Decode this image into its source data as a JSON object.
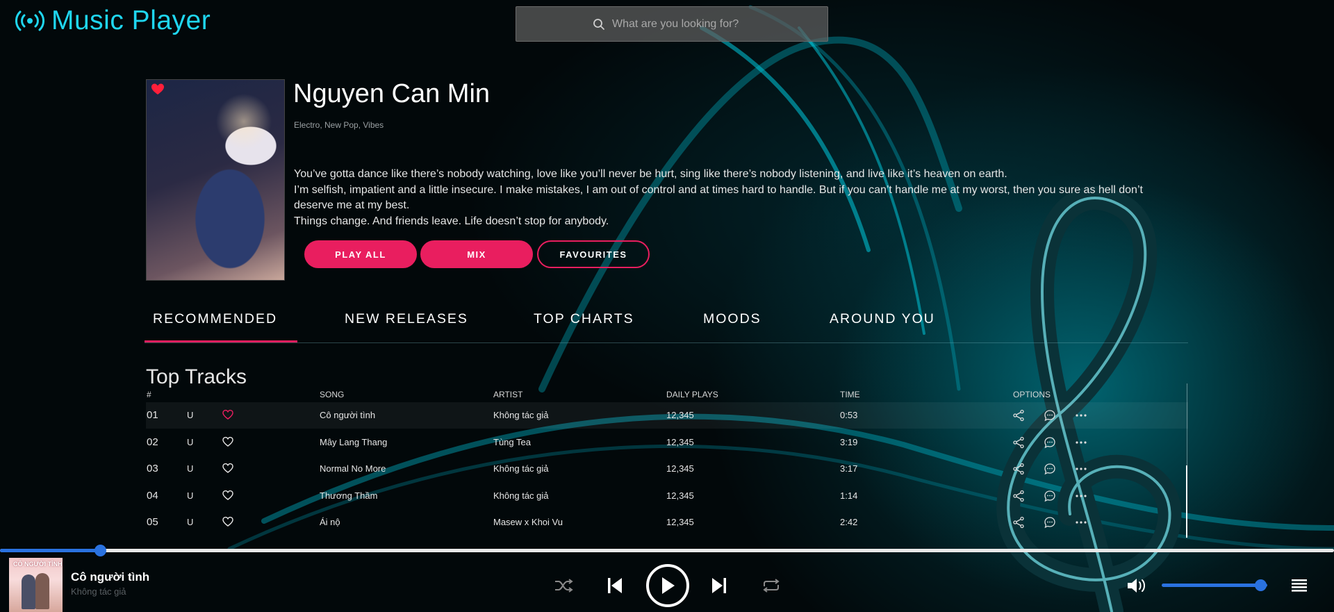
{
  "app": {
    "title": "Music Player",
    "accent": "#1fd6f0",
    "brand_pink": "#e91e5f",
    "player_blue": "#2a72e0"
  },
  "search": {
    "placeholder": "What are you looking for?",
    "value": ""
  },
  "artist": {
    "name": "Nguyen Can Min",
    "genres": "Electro, New Pop, Vibes",
    "bio": [
      "You’ve gotta dance like there’s nobody watching, love like you’ll never be hurt, sing like there’s nobody listening, and live like it’s heaven on earth.",
      "I’m selfish, impatient and a little insecure. I make mistakes, I am out of control and at times hard to handle. But if you can’t handle me at my worst, then you sure as hell don’t deserve me at my best.",
      "Things change. And friends leave. Life doesn’t stop for anybody."
    ],
    "favorited": true,
    "buttons": {
      "play_all": "PLAY ALL",
      "mix": "MIX",
      "favourites": "FAVOURITES"
    }
  },
  "tabs": [
    {
      "label": "RECOMMENDED",
      "active": true
    },
    {
      "label": "NEW RELEASES",
      "active": false
    },
    {
      "label": "TOP CHARTS",
      "active": false
    },
    {
      "label": "MOODS",
      "active": false
    },
    {
      "label": "AROUND YOU",
      "active": false
    }
  ],
  "tracks": {
    "title": "Top Tracks",
    "headers": {
      "num": "#",
      "song": "SONG",
      "artist": "ARTIST",
      "plays": "DAILY PLAYS",
      "time": "TIME",
      "options": "OPTIONS"
    },
    "rows": [
      {
        "num": "01",
        "tag": "U",
        "liked": true,
        "song": "Cô người tình",
        "artist": "Không tác giả",
        "plays": "12,345",
        "time": "0:53"
      },
      {
        "num": "02",
        "tag": "U",
        "liked": false,
        "song": "Mây Lang Thang",
        "artist": "Tùng Tea",
        "plays": "12,345",
        "time": "3:19"
      },
      {
        "num": "03",
        "tag": "U",
        "liked": false,
        "song": "Normal No More",
        "artist": "Không tác giả",
        "plays": "12,345",
        "time": "3:17"
      },
      {
        "num": "04",
        "tag": "U",
        "liked": false,
        "song": "Thương Thầm",
        "artist": "Không tác giả",
        "plays": "12,345",
        "time": "1:14"
      },
      {
        "num": "05",
        "tag": "U",
        "liked": false,
        "song": "Ái nộ",
        "artist": "Masew x Khoi Vu",
        "plays": "12,345",
        "time": "2:42"
      }
    ]
  },
  "player": {
    "title": "Cô người tình",
    "artist": "Không tác giả",
    "cover_text": "CÔ NGƯỜI TÌNH",
    "progress": 0.075,
    "volume": 0.82,
    "controls": [
      "shuffle-icon",
      "previous-icon",
      "play-icon",
      "next-icon",
      "repeat-icon",
      "volume-icon",
      "queue-icon"
    ]
  }
}
